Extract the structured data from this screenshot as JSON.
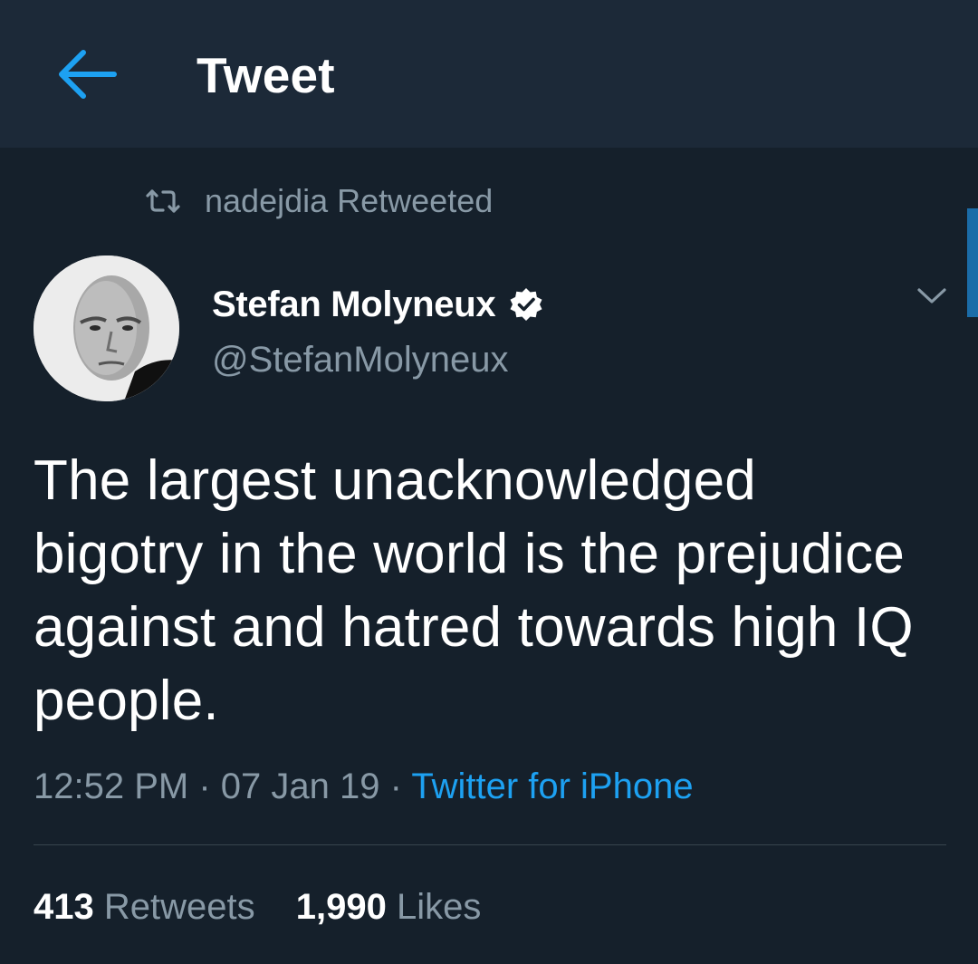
{
  "colors": {
    "background": "#15202b",
    "header_background": "#1c2938",
    "accent": "#1da1f2",
    "secondary_text": "#8899a6",
    "primary_text": "#ffffff",
    "divider": "#38444d"
  },
  "header": {
    "back_icon": "arrow-left-icon",
    "title": "Tweet"
  },
  "retweet_context": {
    "icon": "retweet-icon",
    "text": "nadejdia Retweeted"
  },
  "author": {
    "avatar": "avatar",
    "name": "Stefan Molyneux",
    "verified_icon": "verified-badge-icon",
    "handle": "@StefanMolyneux"
  },
  "caret_icon": "chevron-down-icon",
  "tweet": {
    "text": "The largest unacknowledged bigotry in the world is the prejudice against and hatred towards high IQ people.",
    "time": "12:52 PM",
    "separator": "·",
    "date": "07 Jan 19",
    "source": "Twitter for iPhone"
  },
  "stats": {
    "retweets_count": "413",
    "retweets_label": "Retweets",
    "likes_count": "1,990",
    "likes_label": "Likes"
  }
}
